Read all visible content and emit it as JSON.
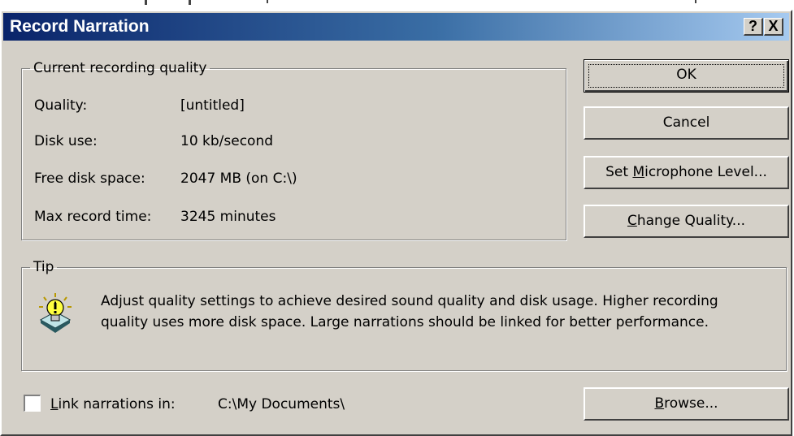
{
  "window": {
    "title": "Record Narration",
    "help_button": "?",
    "close_button": "X"
  },
  "quality_group": {
    "legend": "Current recording quality",
    "rows": [
      {
        "label": "Quality:",
        "value": "[untitled]"
      },
      {
        "label": "Disk use:",
        "value": "10 kb/second"
      },
      {
        "label": "Free disk space:",
        "value": "2047 MB (on C:\\)"
      },
      {
        "label": "Max record time:",
        "value": "3245 minutes"
      }
    ]
  },
  "buttons": {
    "ok": "OK",
    "cancel": "Cancel",
    "set_mic_pre": "Set ",
    "set_mic_key": "M",
    "set_mic_post": "icrophone Level...",
    "change_quality_key": "C",
    "change_quality_post": "hange Quality...",
    "browse_key": "B",
    "browse_post": "rowse..."
  },
  "tip": {
    "legend": "Tip",
    "text": "Adjust quality settings to achieve desired sound quality and disk usage. Higher recording quality uses more disk space. Large narrations should be linked for better performance."
  },
  "link": {
    "key": "L",
    "label_post": "ink narrations in:",
    "path": "C:\\My Documents\\",
    "checked": false
  },
  "icons": {
    "tip": "lightbulb-tip-icon",
    "help": "help-icon",
    "close": "close-icon"
  }
}
